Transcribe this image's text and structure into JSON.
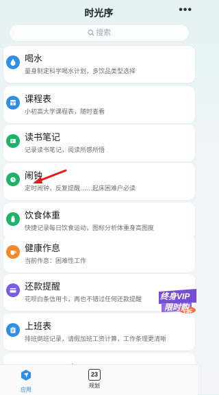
{
  "header": {
    "title": "时光序",
    "more_icon": "more-dots-icon"
  },
  "search": {
    "placeholder": "搜索"
  },
  "apps": [
    {
      "name": "喝水",
      "desc": "量身制定科学喝水计划，多饮品类型选择",
      "icon": "water-drop-icon",
      "color": "#2f8fe6"
    },
    {
      "name": "课程表",
      "desc": "小初高大学课程表，随时查看",
      "icon": "calendar-grid-icon",
      "color": "#2f8fe6"
    },
    {
      "name": "读书笔记",
      "desc": "记录读书笔记，阅读所感所悟",
      "icon": "note-icon",
      "color": "#1fb36a"
    },
    {
      "name": "闹钟",
      "desc": "定时闹钟，反复提醒……起床困难户必读",
      "icon": "alarm-clock-icon",
      "color": "#1fb36a"
    },
    {
      "name": "饮食体重",
      "desc": "快捷记录每日饮食运动，图标分析体重身高图度",
      "icon": "bottle-icon",
      "color": "#1fb36a"
    },
    {
      "name": "健康作息",
      "desc": "当前作息：困难性工作",
      "icon": "cup-icon",
      "color": "#f08a2a"
    },
    {
      "name": "还款提醒",
      "desc": "花呗白条信用卡，再也不错过任何还款提醒",
      "icon": "credit-card-icon",
      "color": "#7a5be8"
    },
    {
      "name": "上班表",
      "desc": "排班倒班记录，请假加班工资计算，工作条理更清晰",
      "icon": "clipboard-icon",
      "color": "#2f8fe6"
    }
  ],
  "promo": {
    "line1": "终身VIP",
    "line2": "限时购",
    "badge": "3折"
  },
  "tabs": [
    {
      "label": "应用",
      "icon": "app-nav-icon",
      "active": true,
      "color": "#2f8fe6"
    },
    {
      "label": "规划",
      "icon": "calendar-23-icon",
      "active": false,
      "badge_number": "23"
    }
  ]
}
